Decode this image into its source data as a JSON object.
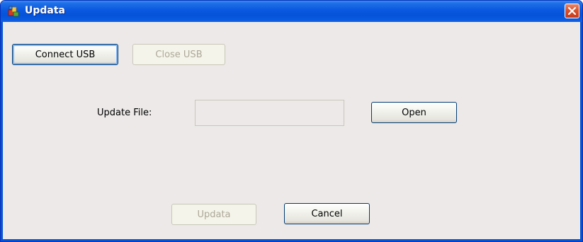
{
  "window": {
    "title": "Updata",
    "icon": "app-icon",
    "close_icon": "close-icon"
  },
  "toolbar": {
    "connect_usb_label": "Connect USB",
    "close_usb_label": "Close USB"
  },
  "file_row": {
    "label": "Update File:",
    "value": "",
    "open_label": "Open"
  },
  "footer": {
    "update_label": "Updata",
    "cancel_label": "Cancel"
  },
  "colors": {
    "title_bar": "#0553d8",
    "close_button": "#d8522d",
    "client_background": "#ece9e8",
    "disabled_text": "#aca899"
  }
}
